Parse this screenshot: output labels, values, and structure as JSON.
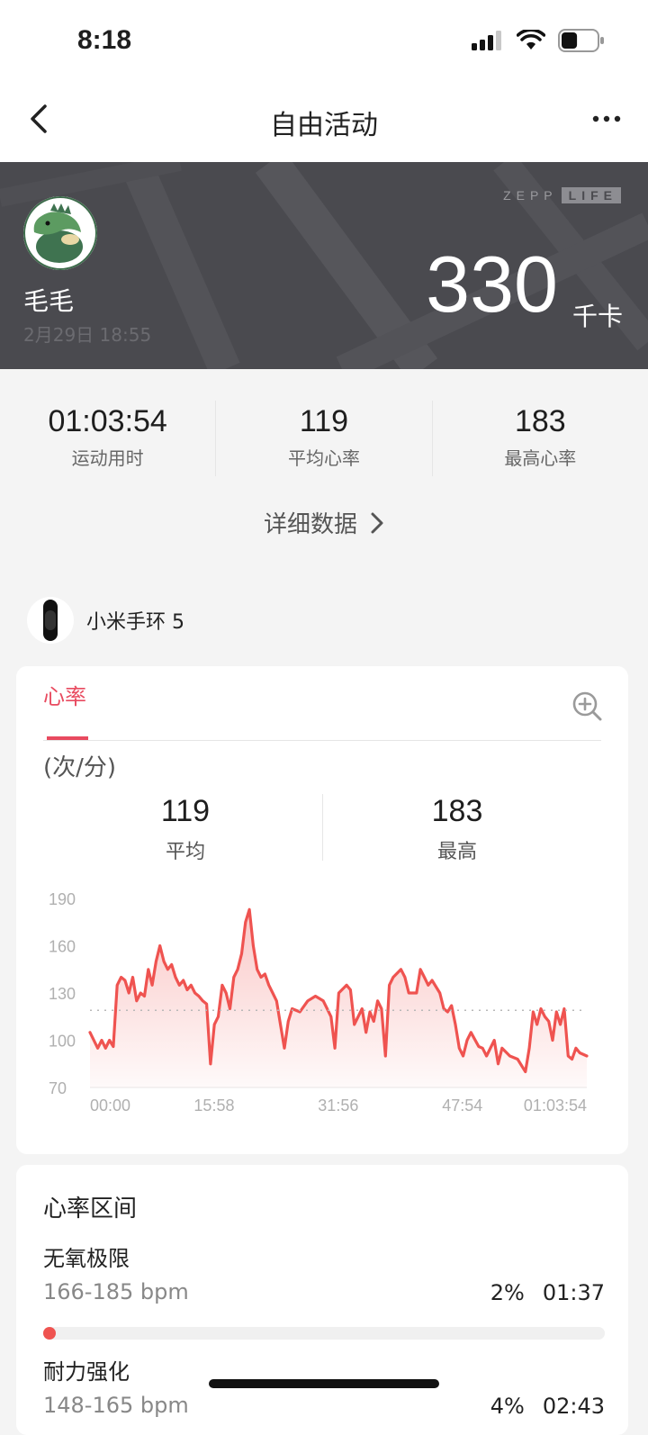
{
  "status_bar": {
    "time": "8:18",
    "battery_level": 0.45
  },
  "nav": {
    "title": "自由活动"
  },
  "hero": {
    "brand_left": "ZEPP",
    "brand_right": "LIFE",
    "user_name": "毛毛",
    "date": "2月29日 18:55",
    "calories": "330",
    "calories_unit": "千卡"
  },
  "stats": [
    {
      "value": "01:03:54",
      "label": "运动用时"
    },
    {
      "value": "119",
      "label": "平均心率"
    },
    {
      "value": "183",
      "label": "最高心率"
    }
  ],
  "details_link": "详细数据",
  "device": {
    "name": "小米手环 5"
  },
  "hr_card": {
    "tab": "心率",
    "unit": "(次/分)",
    "avg_value": "119",
    "avg_label": "平均",
    "max_value": "183",
    "max_label": "最高"
  },
  "chart_data": {
    "type": "area",
    "ylabel": "",
    "xlabel": "",
    "ylim": [
      70,
      190
    ],
    "y_ticks": [
      "190",
      "160",
      "130",
      "100",
      "70"
    ],
    "x_tick_labels": [
      "00:00",
      "15:58",
      "31:56",
      "47:54",
      "01:03:54"
    ],
    "x_ticks_minutes": [
      0,
      15.97,
      31.93,
      47.9,
      63.9
    ],
    "xlim_minutes": [
      0,
      63.9
    ],
    "average_line": 119,
    "accent_color": "#ef5350",
    "series": [
      {
        "x": [
          0,
          1,
          1.5,
          2,
          2.5,
          3,
          3.5,
          4,
          4.5,
          5,
          5.5,
          6,
          6.5,
          7,
          7.5,
          8,
          8.5,
          9,
          9.5,
          10,
          10.5,
          11,
          11.5,
          12,
          12.5,
          13,
          13.5,
          14,
          14.5,
          15,
          15.5,
          16,
          16.5,
          17,
          17.5,
          18,
          18.5,
          19,
          19.5,
          20,
          20.5,
          21,
          21.5,
          22,
          22.5,
          23,
          23.5,
          24,
          24.5,
          25,
          25.5,
          26,
          27,
          28,
          29,
          30,
          30.5,
          31,
          31.5,
          32,
          33,
          33.5,
          34,
          35,
          35.5,
          36,
          36.5,
          37,
          37.5,
          38,
          38.5,
          39,
          40,
          40.5,
          41,
          42,
          42.5,
          43,
          43.5,
          44,
          45,
          45.5,
          46,
          46.5,
          47,
          47.5,
          48,
          48.5,
          49,
          50,
          50.5,
          51,
          52,
          52.5,
          53,
          54,
          55,
          56,
          56.5,
          57,
          57.5,
          58,
          58.5,
          59,
          59.5,
          60,
          60.5,
          61,
          61.5,
          62,
          62.5,
          63,
          63.9
        ],
        "y": [
          105,
          95,
          100,
          95,
          100,
          96,
          135,
          140,
          138,
          130,
          140,
          125,
          130,
          128,
          145,
          135,
          150,
          160,
          150,
          145,
          148,
          140,
          135,
          138,
          132,
          135,
          130,
          128,
          125,
          123,
          85,
          110,
          115,
          135,
          130,
          120,
          140,
          145,
          155,
          175,
          183,
          160,
          145,
          140,
          142,
          135,
          130,
          125,
          110,
          95,
          112,
          120,
          118,
          125,
          128,
          125,
          120,
          115,
          95,
          130,
          135,
          132,
          110,
          120,
          105,
          118,
          112,
          125,
          120,
          90,
          135,
          140,
          145,
          140,
          130,
          130,
          145,
          140,
          135,
          138,
          130,
          120,
          118,
          122,
          110,
          95,
          90,
          100,
          105,
          96,
          95,
          90,
          100,
          85,
          95,
          90,
          88,
          80,
          95,
          118,
          110,
          120,
          115,
          112,
          100,
          118,
          110,
          120,
          90,
          88,
          95,
          92,
          90
        ]
      }
    ]
  },
  "zones": {
    "title": "心率区间",
    "items": [
      {
        "name": "无氧极限",
        "range": "166-185 bpm",
        "percent": "2%",
        "time": "01:37",
        "fraction": 0.02
      },
      {
        "name": "耐力强化",
        "range": "148-165 bpm",
        "percent": "4%",
        "time": "02:43",
        "fraction": 0.04
      }
    ]
  }
}
